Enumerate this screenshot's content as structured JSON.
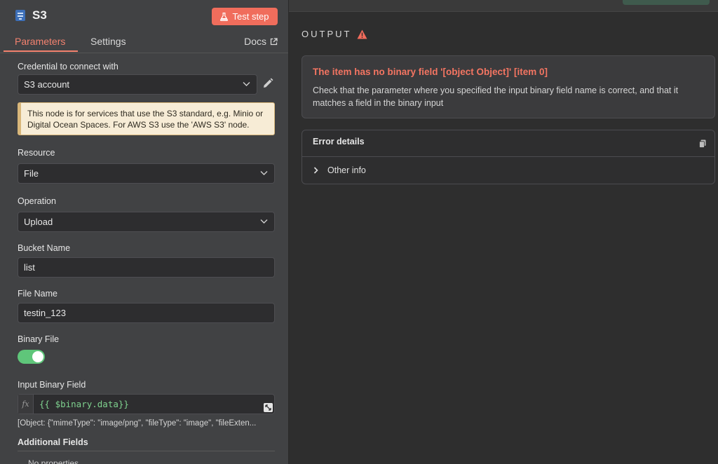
{
  "node": {
    "title": "S3",
    "test_button": "Test step"
  },
  "tabs": [
    {
      "label": "Parameters",
      "active": true
    },
    {
      "label": "Settings",
      "active": false
    }
  ],
  "docs_label": "Docs",
  "credential": {
    "label": "Credential to connect with",
    "value": "S3 account"
  },
  "notice": "This node is for services that use the S3 standard, e.g. Minio or Digital Ocean Spaces. For AWS S3 use the 'AWS S3' node.",
  "resource": {
    "label": "Resource",
    "value": "File"
  },
  "operation": {
    "label": "Operation",
    "value": "Upload"
  },
  "bucket": {
    "label": "Bucket Name",
    "value": "list"
  },
  "file_name": {
    "label": "File Name",
    "value": "testin_123"
  },
  "binary_file": {
    "label": "Binary File",
    "enabled": true
  },
  "input_binary": {
    "label": "Input Binary Field",
    "fx": "fx",
    "expression": "{{ $binary.data}}",
    "hint": "[Object: {\"mimeType\": \"image/png\", \"fileType\": \"image\", \"fileExten..."
  },
  "additional_fields": {
    "label": "Additional Fields",
    "empty": "No properties"
  },
  "output": {
    "title": "OUTPUT",
    "error_title": "The item has no binary field '[object Object]' [item 0]",
    "error_message": "Check that the parameter where you specified the input binary field name is correct, and that it matches a field in the binary input",
    "details_title": "Error details",
    "other_info": "Other info"
  },
  "colors": {
    "accent": "#f3826f",
    "error": "#f47562",
    "toggle_on": "#5fc67a",
    "expression": "#7fd28f"
  },
  "icons": [
    "s3-node-icon",
    "flask-icon",
    "external-link-icon",
    "chevron-down-icon",
    "pencil-icon",
    "warning-icon",
    "copy-icon",
    "chevron-right-icon",
    "expand-icon"
  ]
}
